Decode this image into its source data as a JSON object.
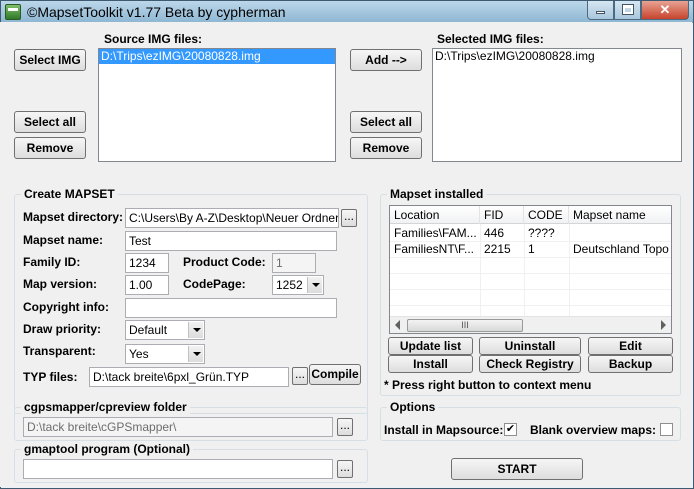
{
  "window": {
    "title": "©MapsetToolkit v1.77 Beta by cypherman"
  },
  "source": {
    "label": "Source IMG files:",
    "items": [
      "D:\\Trips\\ezIMG\\20080828.img"
    ],
    "select_img": "Select IMG",
    "select_all": "Select all",
    "remove": "Remove"
  },
  "selected": {
    "label": "Selected IMG files:",
    "items": [
      "D:\\Trips\\ezIMG\\20080828.img"
    ],
    "add": "Add -->",
    "select_all": "Select all",
    "remove": "Remove"
  },
  "create": {
    "title": "Create MAPSET",
    "mapset_directory_label": "Mapset directory:",
    "mapset_directory": "C:\\Users\\By A-Z\\Desktop\\Neuer Ordner",
    "mapset_name_label": "Mapset name:",
    "mapset_name": "Test",
    "family_id_label": "Family ID:",
    "family_id": "1234",
    "product_code_label": "Product Code:",
    "product_code": "1",
    "map_version_label": "Map version:",
    "map_version": "1.00",
    "codepage_label": "CodePage:",
    "codepage": "1252",
    "copyright_label": "Copyright info:",
    "copyright": "",
    "draw_priority_label": "Draw priority:",
    "draw_priority": "Default",
    "transparent_label": "Transparent:",
    "transparent": "Yes",
    "typ_label": "TYP files:",
    "typ": "D:\\tack breite\\6pxl_Grün.TYP",
    "browse": "...",
    "compile": "Compile"
  },
  "installed": {
    "title": "Mapset installed",
    "columns": [
      "Location",
      "FID",
      "CODE",
      "Mapset name"
    ],
    "rows": [
      [
        "Families\\FAM...",
        "446",
        "????",
        ""
      ],
      [
        "FamiliesNT\\F...",
        "2215",
        "1",
        "Deutschland Topo"
      ]
    ],
    "scroll_grip": "III",
    "update_list": "Update list",
    "uninstall": "Uninstall",
    "edit": "Edit",
    "install": "Install",
    "check_registry": "Check Registry",
    "backup": "Backup",
    "hint": "* Press right button to context menu"
  },
  "cgps": {
    "title": "cgpsmapper/cpreview folder",
    "path": "D:\\tack breite\\cGPSmapper\\",
    "browse": "..."
  },
  "gmaptool": {
    "title": "gmaptool program (Optional)",
    "path": "",
    "browse": "..."
  },
  "options": {
    "title": "Options",
    "install_in_mapsource_label": "Install in Mapsource:",
    "install_in_mapsource": true,
    "blank_overview_label": "Blank overview maps:",
    "blank_overview": false
  },
  "start": "START"
}
